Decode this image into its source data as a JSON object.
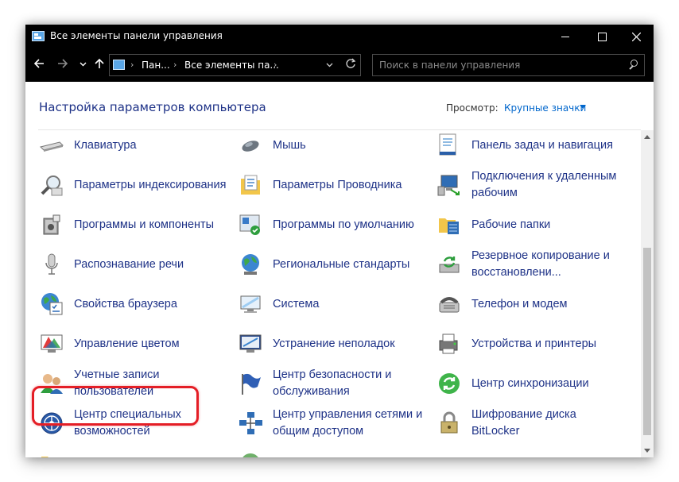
{
  "window": {
    "title": "Все элементы панели управления"
  },
  "address": {
    "crumb1": "Пан...",
    "crumb2": "Все элементы па...",
    "sep": "›"
  },
  "search": {
    "placeholder": "Поиск в панели управления"
  },
  "header": {
    "title": "Настройка параметров компьютера",
    "view_label": "Просмотр:",
    "view_value": "Крупные значки"
  },
  "items": [
    {
      "label": "Клавиатура",
      "icon": "keyboard-icon"
    },
    {
      "label": "Мышь",
      "icon": "mouse-icon"
    },
    {
      "label": "Панель задач и навигация",
      "icon": "taskbar-icon"
    },
    {
      "label": "Параметры индексирования",
      "icon": "indexing-icon"
    },
    {
      "label": "Параметры Проводника",
      "icon": "explorer-options-icon"
    },
    {
      "label": "Подключения к удаленным рабочим",
      "icon": "remote-desktop-icon"
    },
    {
      "label": "Программы и компоненты",
      "icon": "programs-icon"
    },
    {
      "label": "Программы по умолчанию",
      "icon": "default-programs-icon"
    },
    {
      "label": "Рабочие папки",
      "icon": "work-folders-icon"
    },
    {
      "label": "Распознавание речи",
      "icon": "microphone-icon"
    },
    {
      "label": "Региональные стандарты",
      "icon": "region-globe-icon"
    },
    {
      "label": "Резервное копирование и восстановлени...",
      "icon": "backup-icon"
    },
    {
      "label": "Свойства браузера",
      "icon": "internet-options-icon"
    },
    {
      "label": "Система",
      "icon": "system-icon"
    },
    {
      "label": "Телефон и модем",
      "icon": "phone-modem-icon"
    },
    {
      "label": "Управление цветом",
      "icon": "color-management-icon"
    },
    {
      "label": "Устранение неполадок",
      "icon": "troubleshooting-icon"
    },
    {
      "label": "Устройства и принтеры",
      "icon": "printer-icon"
    },
    {
      "label": "Учетные записи пользователей",
      "icon": "user-accounts-icon"
    },
    {
      "label": "Центр безопасности и обслуживания",
      "icon": "security-flag-icon"
    },
    {
      "label": "Центр синхронизации",
      "icon": "sync-center-icon"
    },
    {
      "label": "Центр специальных возможностей",
      "icon": "accessibility-icon"
    },
    {
      "label": "Центр управления сетями и общим доступом",
      "icon": "network-icon"
    },
    {
      "label": "Шифрование диска BitLocker",
      "icon": "bitlocker-icon"
    }
  ],
  "colors": {
    "link": "#1e3287",
    "highlight": "#e41e26",
    "titlebar": "#000000"
  }
}
